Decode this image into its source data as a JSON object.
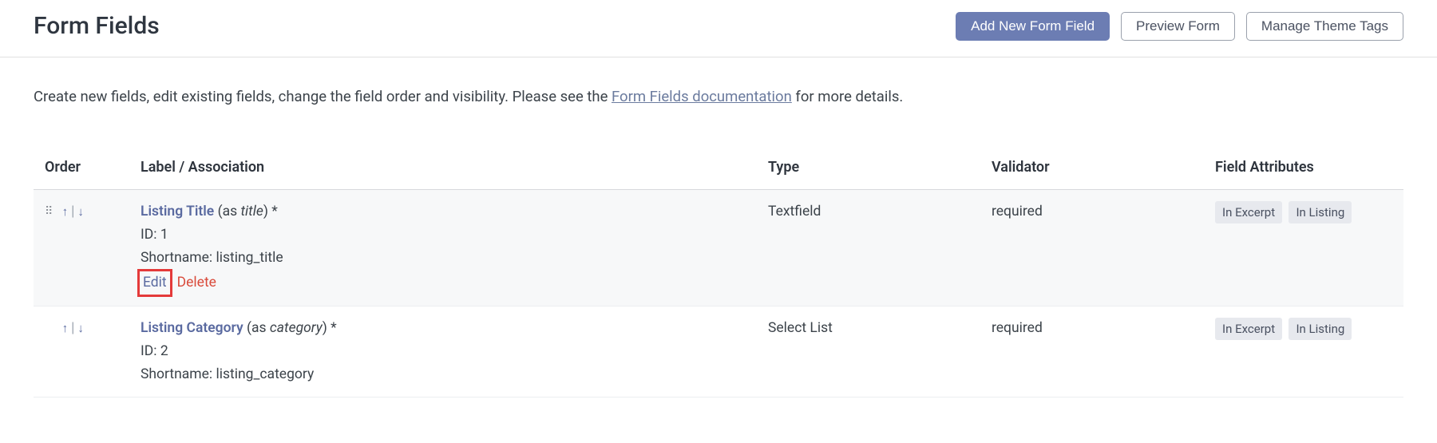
{
  "page_title": "Form Fields",
  "buttons": {
    "add_new": "Add New Form Field",
    "preview": "Preview Form",
    "manage_tags": "Manage Theme Tags"
  },
  "intro": {
    "pre": "Create new fields, edit existing fields, change the field order and visibility. Please see the ",
    "link": "Form Fields documentation",
    "post": " for more details."
  },
  "table": {
    "headers": {
      "order": "Order",
      "label": "Label / Association",
      "type": "Type",
      "validator": "Validator",
      "attributes": "Field Attributes"
    },
    "rows": [
      {
        "label": "Listing Title",
        "slug_prefix": " (as ",
        "slug": "title",
        "slug_suffix": ") *",
        "id_line": "ID: 1",
        "shortname_line": "Shortname: listing_title",
        "edit": "Edit",
        "delete": "Delete",
        "type": "Textfield",
        "validator": "required",
        "attr1": "In Excerpt",
        "attr2": "In Listing"
      },
      {
        "label": "Listing Category",
        "slug_prefix": " (as ",
        "slug": "category",
        "slug_suffix": ") *",
        "id_line": "ID: 2",
        "shortname_line": "Shortname: listing_category",
        "type": "Select List",
        "validator": "required",
        "attr1": "In Excerpt",
        "attr2": "In Listing"
      }
    ]
  }
}
